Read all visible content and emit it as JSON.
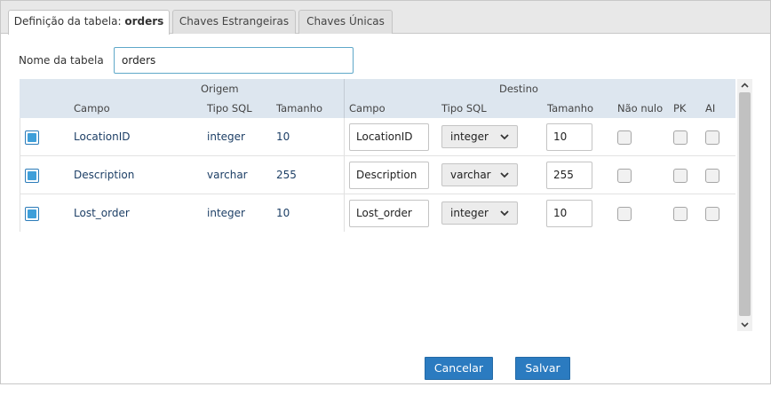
{
  "tabs": [
    {
      "label": "Definição da tabela: ",
      "bold": "orders"
    },
    {
      "label": "Chaves Estrangeiras"
    },
    {
      "label": "Chaves Únicas"
    }
  ],
  "table_name": {
    "label": "Nome da tabela",
    "value": "orders"
  },
  "grid": {
    "group_origin": "Origem",
    "group_dest": "Destino",
    "columns": {
      "field": "Campo",
      "sql_type": "Tipo SQL",
      "size": "Tamanho",
      "dest_field": "Campo",
      "dest_sql_type": "Tipo SQL",
      "dest_size": "Tamanho",
      "not_null": "Não nulo",
      "pk": "PK",
      "ai": "AI"
    },
    "rows": [
      {
        "field": "LocationID",
        "sql_type": "integer",
        "size": "10",
        "dest_field": "LocationID",
        "dest_type": "integer",
        "dest_size": "10"
      },
      {
        "field": "Description",
        "sql_type": "varchar",
        "size": "255",
        "dest_field": "Description",
        "dest_type": "varchar",
        "dest_size": "255"
      },
      {
        "field": "Lost_order",
        "sql_type": "integer",
        "size": "10",
        "dest_field": "Lost_order",
        "dest_type": "integer",
        "dest_size": "10"
      }
    ]
  },
  "buttons": {
    "cancel": "Cancelar",
    "save": "Salvar"
  },
  "colors": {
    "accent": "#2b7bc0",
    "header_bg": "#dde6ef",
    "text_link": "#1d3f66"
  }
}
